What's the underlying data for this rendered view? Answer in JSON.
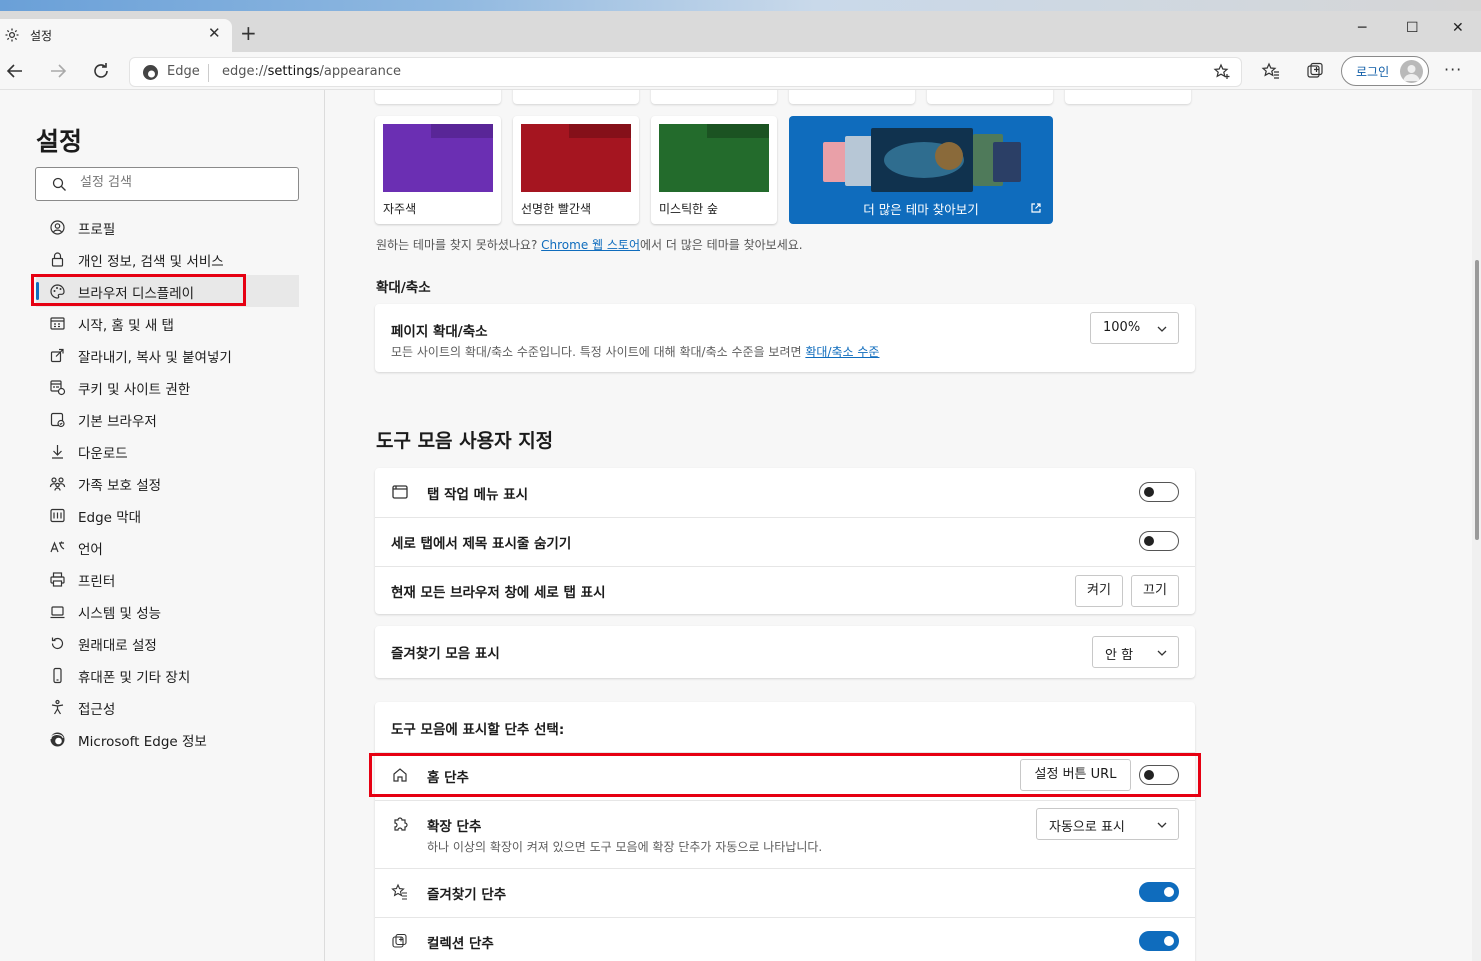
{
  "window": {
    "tab_title": "설정",
    "new_tab": "+",
    "minimize": "─",
    "maximize": "☐",
    "close": "✕"
  },
  "address_bar": {
    "site_label": "Edge",
    "url_prefix": "edge://",
    "url_host": "settings",
    "url_path": "/appearance",
    "login_label": "로그인"
  },
  "sidebar": {
    "title": "설정",
    "search_placeholder": "설정 검색",
    "items": [
      {
        "label": "프로필",
        "icon": "profile-icon"
      },
      {
        "label": "개인 정보, 검색 및 서비스",
        "icon": "lock-icon"
      },
      {
        "label": "브라우저 디스플레이",
        "icon": "palette-icon",
        "active": true
      },
      {
        "label": "시작, 홈 및 새 탭",
        "icon": "home-grid-icon"
      },
      {
        "label": "잘라내기, 복사 및 붙여넣기",
        "icon": "share-icon"
      },
      {
        "label": "쿠키 및 사이트 권한",
        "icon": "cookie-icon"
      },
      {
        "label": "기본 브라우저",
        "icon": "browser-icon"
      },
      {
        "label": "다운로드",
        "icon": "download-icon"
      },
      {
        "label": "가족 보호 설정",
        "icon": "family-icon"
      },
      {
        "label": "Edge 막대",
        "icon": "edge-bar-icon"
      },
      {
        "label": "언어",
        "icon": "language-icon"
      },
      {
        "label": "프린터",
        "icon": "printer-icon"
      },
      {
        "label": "시스템 및 성능",
        "icon": "laptop-icon"
      },
      {
        "label": "원래대로 설정",
        "icon": "reset-icon"
      },
      {
        "label": "휴대폰 및 기타 장치",
        "icon": "phone-icon"
      },
      {
        "label": "접근성",
        "icon": "accessibility-icon"
      },
      {
        "label": "Microsoft Edge 정보",
        "icon": "edge-logo-icon"
      }
    ]
  },
  "themes": {
    "cards": [
      {
        "label": "자주색",
        "color": "#6b2fb3",
        "bar": "#4a1f80"
      },
      {
        "label": "선명한 빨간색",
        "color": "#a51520",
        "bar": "#6b0d14"
      },
      {
        "label": "미스틱한 숲",
        "color": "#236b2c",
        "bar": "#163f1b"
      }
    ],
    "more_label": "더 많은 테마 찾아보기",
    "hint_before": "원하는 테마를 찾지 못하셨나요? ",
    "hint_link": "Chrome 웹 스토어",
    "hint_after": "에서 더 많은 테마를 찾아보세요."
  },
  "zoom": {
    "section_title": "확대/축소",
    "row_title": "페이지 확대/축소",
    "row_sub": "모든 사이트의 확대/축소 수준입니다. 특정 사이트에 대해 확대/축소 수준을 보려면 ",
    "row_sub_link": "확대/축소 수준",
    "value": "100%"
  },
  "toolbar_custom": {
    "section_title": "도구 모음 사용자 지정",
    "tab_actions": {
      "label": "탭 작업 메뉴 표시",
      "on": false
    },
    "hide_title_bar": {
      "label": "세로 탭에서 제목 표시줄 숨기기",
      "on": false
    },
    "vertical_tabs": {
      "label": "현재 모든 브라우저 창에 세로 탭 표시",
      "on_label": "켜기",
      "off_label": "끄기"
    },
    "favorites_bar": {
      "label": "즐겨찾기 모음 표시",
      "value": "안 함"
    },
    "buttons_heading": "도구 모음에 표시할 단추 선택:",
    "home_button": {
      "label": "홈 단추",
      "set_url_label": "설정 버튼 URL",
      "on": false
    },
    "extensions_button": {
      "label": "확장 단추",
      "sub": "하나 이상의 확장이 켜져 있으면 도구 모음에 확장 단추가 자동으로 나타납니다.",
      "value": "자동으로 표시"
    },
    "favorites_button": {
      "label": "즐겨찾기 단추",
      "on": true
    },
    "collections_button": {
      "label": "컬렉션 단추",
      "on": true
    }
  },
  "colors": {
    "accent": "#0f6cbd",
    "highlight_box": "#e60012"
  }
}
